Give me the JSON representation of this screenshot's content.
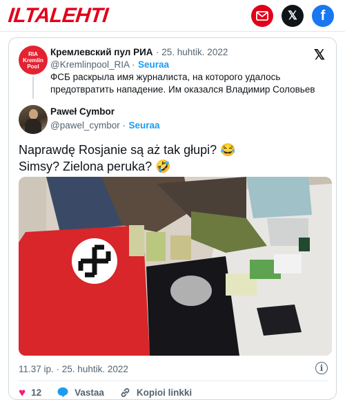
{
  "site": {
    "logo": "ILTALEHTI"
  },
  "share": {
    "mail_icon": "mail-icon",
    "x_label": "𝕏",
    "fb_label": "f"
  },
  "quoted": {
    "avatar_lines": [
      "RIA",
      "Kremlin",
      "Pool"
    ],
    "name": "Кремлевский пул РИА",
    "date": "· 25. huhtik. 2022",
    "handle": "@Kremlinpool_RIA ·",
    "follow": "Seuraa",
    "text": "ФСБ раскрыла имя журналиста, на которого удалось предотвратить нападение. Им оказался Владимир Соловьев"
  },
  "reply": {
    "name": "Paweł Cymbor",
    "handle": "@pawel_cymbor ·",
    "follow": "Seuraa",
    "text_line1": "Naprawdę Rosjanie są aż tak głupi? 😂",
    "text_line2": "Simsy? Zielona peruka? 🤣"
  },
  "footer": {
    "timestamp": "11.37 ip. · 25. huhtik. 2022",
    "info": "i",
    "likes": "12",
    "reply_label": "Vastaa",
    "copy_label": "Kopioi linkki"
  },
  "colors": {
    "brand": "#e2001a",
    "link": "#1d9bf0",
    "like": "#f91880"
  }
}
